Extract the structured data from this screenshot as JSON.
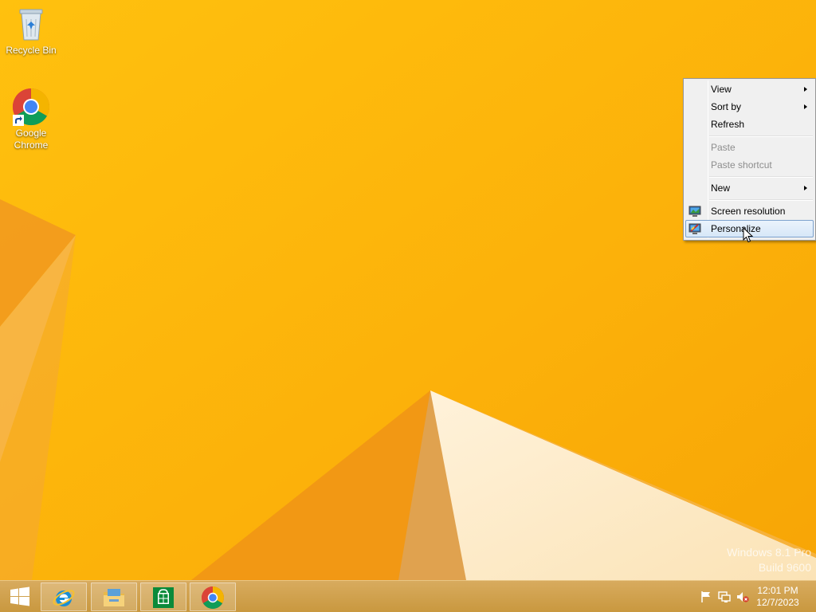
{
  "desktop": {
    "icons": [
      {
        "label": "Recycle Bin"
      },
      {
        "label": "Google Chrome"
      }
    ],
    "watermark": {
      "line1": "Windows 8.1 Pro",
      "line2": "Build 9600"
    }
  },
  "context_menu": {
    "items": [
      {
        "label": "View",
        "submenu": true,
        "enabled": true
      },
      {
        "label": "Sort by",
        "submenu": true,
        "enabled": true
      },
      {
        "label": "Refresh",
        "enabled": true
      },
      {
        "label": "Paste",
        "enabled": false
      },
      {
        "label": "Paste shortcut",
        "enabled": false
      },
      {
        "label": "New",
        "submenu": true,
        "enabled": true
      },
      {
        "label": "Screen resolution",
        "icon": "monitor-icon",
        "enabled": true
      },
      {
        "label": "Personalize",
        "icon": "personalize-icon",
        "enabled": true,
        "highlighted": true
      }
    ]
  },
  "taskbar": {
    "pinned": [
      {
        "name": "Internet Explorer",
        "icon": "internet-explorer-icon"
      },
      {
        "name": "File Explorer",
        "icon": "file-explorer-icon"
      },
      {
        "name": "Store",
        "icon": "store-icon"
      },
      {
        "name": "Google Chrome",
        "icon": "chrome-icon"
      }
    ],
    "tray": {
      "icons": [
        "flag-icon",
        "network-icon",
        "volume-muted-icon"
      ],
      "time": "12:01 PM",
      "date": "12/7/2023"
    }
  },
  "colors": {
    "wallpaper": "#fdb50a",
    "menu_highlight": "#d7e7f8",
    "taskbar": "#c9983f"
  }
}
